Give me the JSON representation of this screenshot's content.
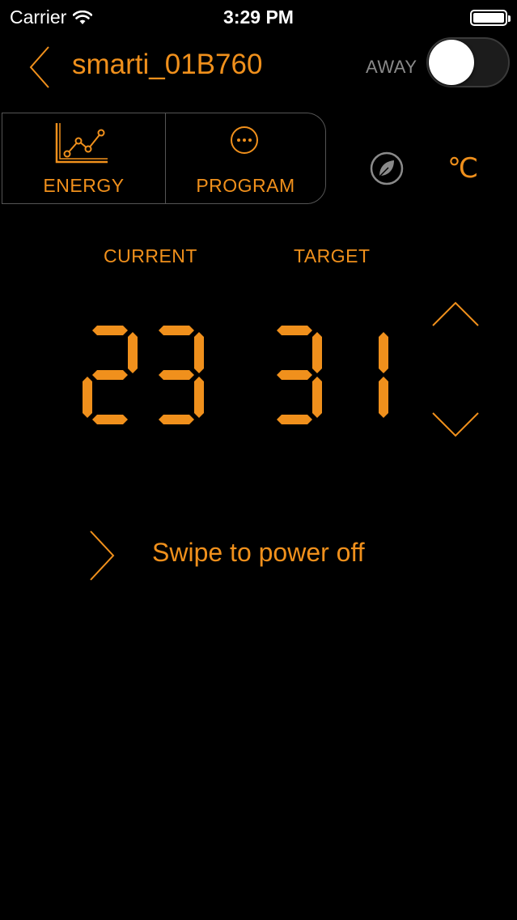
{
  "status_bar": {
    "carrier": "Carrier",
    "time": "3:29 PM"
  },
  "header": {
    "device_name": "smarti_01B760",
    "away_label": "AWAY",
    "away_enabled": false
  },
  "tabs": [
    {
      "label": "ENERGY",
      "icon": "line-chart-icon"
    },
    {
      "label": "PROGRAM",
      "icon": "more-dots-icon"
    }
  ],
  "eco_icon": "leaf-icon",
  "unit": "℃",
  "temperature": {
    "current_label": "CURRENT",
    "target_label": "TARGET",
    "current_value": "23",
    "target_value": "31"
  },
  "swipe_text": "Swipe to power off",
  "colors": {
    "accent": "#f0901c",
    "background": "#000000",
    "muted": "#8a8a8a"
  }
}
